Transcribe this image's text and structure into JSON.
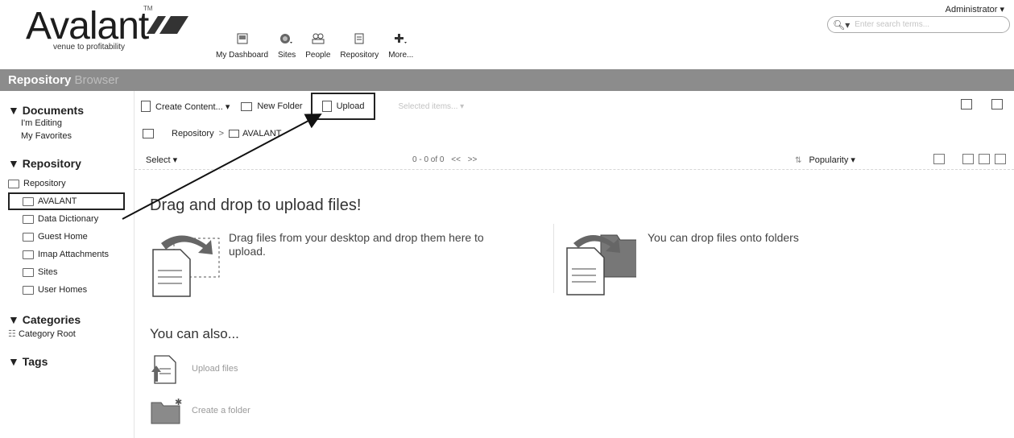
{
  "header": {
    "logo_word": "Avalant",
    "logo_tm": "TM",
    "logo_tagline": "venue to profitability",
    "nav": [
      {
        "label": "My Dashboard",
        "icon": "dashboard-icon"
      },
      {
        "label": "Sites",
        "icon": "sites-icon"
      },
      {
        "label": "People",
        "icon": "people-icon"
      },
      {
        "label": "Repository",
        "icon": "repository-icon"
      },
      {
        "label": "More...",
        "icon": "plus-icon"
      }
    ],
    "user_menu": "Administrator ▾",
    "search_placeholder": "Enter search terms..."
  },
  "titlebar": {
    "title_strong": "Repository",
    "title_light": " Browser"
  },
  "sidebar": {
    "documents_heading": "▼ Documents",
    "documents_links": [
      "I'm Editing",
      "My Favorites"
    ],
    "repository_heading": "▼ Repository",
    "repository_root": "Repository",
    "repository_children": [
      "AVALANT",
      "Data Dictionary",
      "Guest Home",
      "Imap Attachments",
      "Sites",
      "User Homes"
    ],
    "selected_child": "AVALANT",
    "categories_heading": "▼ Categories",
    "category_root": "Category Root",
    "tags_heading": "▼ Tags"
  },
  "toolbar": {
    "create_content": "Create Content... ▾",
    "new_folder": "New Folder",
    "upload": "Upload",
    "selected_items": "Selected items... ▾"
  },
  "breadcrumb": {
    "root": "Repository",
    "separator": ">",
    "current": "AVALANT"
  },
  "listbar": {
    "select": "Select ▾",
    "pager_range": "0 - 0 of 0",
    "pager_prev": "<<",
    "pager_next": ">>",
    "sort_label": "Popularity ▾"
  },
  "main": {
    "dnd_title": "Drag and drop to upload files!",
    "dnd_left_text": "Drag files from your desktop and drop them here to upload.",
    "dnd_right_text": "You can drop files onto folders",
    "also_title": "You can also...",
    "also_upload": "Upload files",
    "also_create_folder": "Create a folder"
  }
}
